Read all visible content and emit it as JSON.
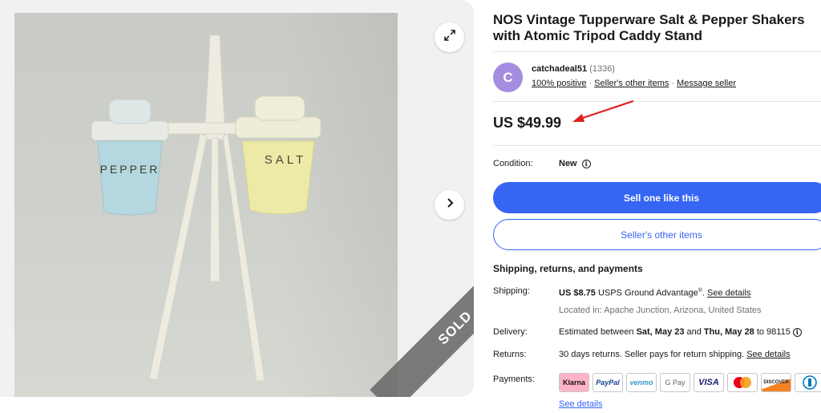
{
  "listing": {
    "title": "NOS Vintage Tupperware Salt & Pepper Shakers with Atomic Tripod Caddy Stand",
    "sold_label": "SOLD",
    "price": "US $49.99"
  },
  "gallery": {
    "icons": {
      "expand": "expand-icon",
      "next": "chevron-right-icon"
    },
    "shaker_labels": {
      "left": "PEPPER",
      "right": "SALT"
    }
  },
  "seller": {
    "avatar_letter": "C",
    "name": "catchadeal51",
    "feedback_count": "(1336)",
    "positive": "100% positive",
    "other_items_link": "Seller's other items",
    "message_link": "Message seller"
  },
  "condition": {
    "label": "Condition:",
    "value": "New"
  },
  "buttons": {
    "sell_similar": "Sell one like this",
    "seller_other_items": "Seller's other items"
  },
  "shipping_section": {
    "heading": "Shipping, returns, and payments",
    "shipping": {
      "label": "Shipping:",
      "cost": "US $8.75",
      "service": "USPS Ground Advantage",
      "reg": "®",
      "link": "See details",
      "location": "Located in: Apache Junction, Arizona, United States"
    },
    "delivery": {
      "label": "Delivery:",
      "prefix": "Estimated between",
      "start": "Sat, May 23",
      "and": "and",
      "end": "Thu, May 28",
      "to": "to 98115"
    },
    "returns": {
      "label": "Returns:",
      "text": "30 days returns. Seller pays for return shipping.",
      "link": "See details"
    },
    "payments": {
      "label": "Payments:",
      "methods": [
        "Klarna",
        "PayPal",
        "venmo",
        "G Pay",
        "VISA",
        "Mastercard",
        "DISCOVER",
        "Diners"
      ],
      "link": "See details"
    }
  },
  "colors": {
    "accent": "#3665f3",
    "annotation_arrow": "#e0201e",
    "avatar": "#a48de0"
  }
}
